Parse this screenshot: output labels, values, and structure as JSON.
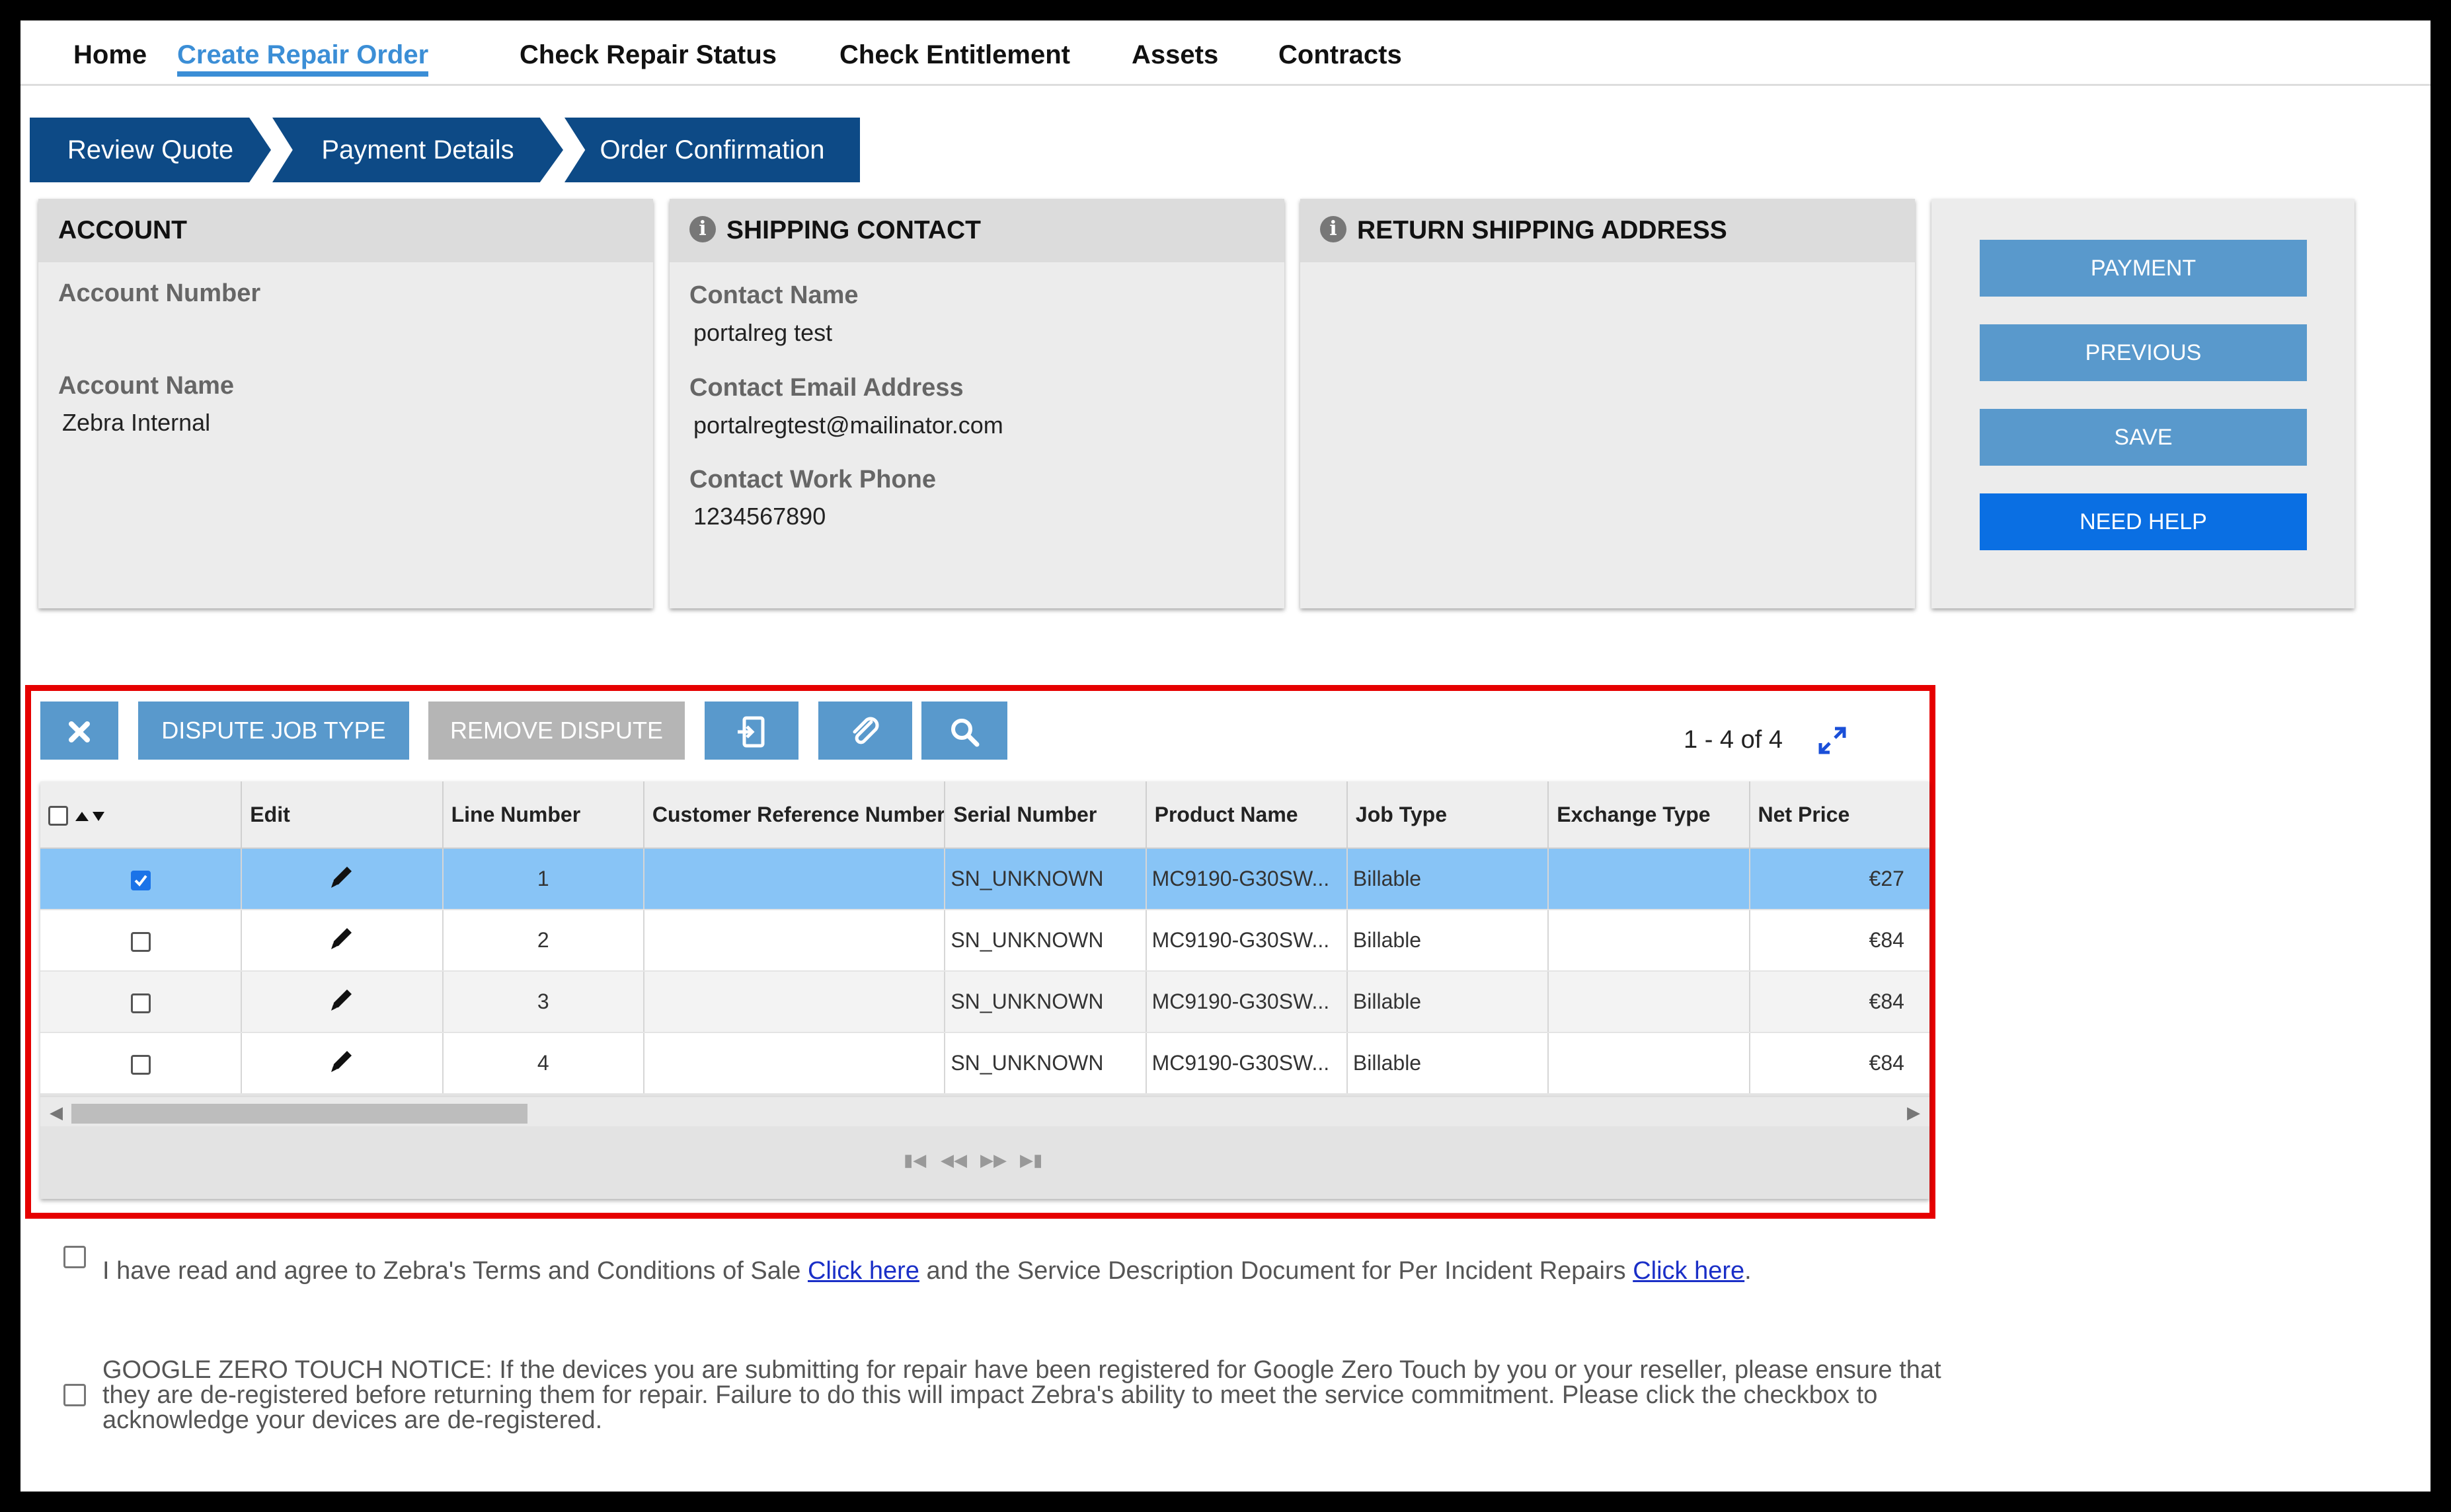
{
  "nav": {
    "items": [
      "Home",
      "Create Repair Order",
      "Check Repair Status",
      "Check Entitlement",
      "Assets",
      "Contracts"
    ],
    "active_index": 1
  },
  "steps": [
    "Review Quote",
    "Payment Details",
    "Order Confirmation"
  ],
  "account": {
    "title": "ACCOUNT",
    "number_label": "Account Number",
    "number_value": "",
    "name_label": "Account Name",
    "name_value": "Zebra Internal"
  },
  "shipping_contact": {
    "title": "SHIPPING CONTACT",
    "name_label": "Contact Name",
    "name_value": "portalreg test",
    "email_label": "Contact Email Address",
    "email_value": "portalregtest@mailinator.com",
    "phone_label": "Contact Work Phone",
    "phone_value": "1234567890"
  },
  "return_address": {
    "title": "RETURN SHIPPING ADDRESS"
  },
  "side_buttons": {
    "payment": "PAYMENT",
    "previous": "PREVIOUS",
    "save": "SAVE",
    "help": "NEED HELP"
  },
  "toolbar": {
    "dispute": "DISPUTE JOB TYPE",
    "remove_dispute": "REMOVE DISPUTE",
    "pager": "1 - 4 of 4"
  },
  "grid": {
    "columns": [
      "Edit",
      "Line Number",
      "Customer Reference Number",
      "Serial Number",
      "Product Name",
      "Job Type",
      "Exchange Type",
      "Net Price"
    ],
    "rows": [
      {
        "checked": true,
        "line": "1",
        "ref": "",
        "serial": "SN_UNKNOWN",
        "product": "MC9190-G30SW...",
        "job": "Billable",
        "exchange": "",
        "price": "€27"
      },
      {
        "checked": false,
        "line": "2",
        "ref": "",
        "serial": "SN_UNKNOWN",
        "product": "MC9190-G30SW...",
        "job": "Billable",
        "exchange": "",
        "price": "€84"
      },
      {
        "checked": false,
        "line": "3",
        "ref": "",
        "serial": "SN_UNKNOWN",
        "product": "MC9190-G30SW...",
        "job": "Billable",
        "exchange": "",
        "price": "€84"
      },
      {
        "checked": false,
        "line": "4",
        "ref": "",
        "serial": "SN_UNKNOWN",
        "product": "MC9190-G30SW...",
        "job": "Billable",
        "exchange": "",
        "price": "€84"
      }
    ]
  },
  "terms": {
    "part1": "I have read and agree to Zebra's Terms and Conditions of Sale ",
    "link1": "Click here",
    "part2": " and the Service Description Document for Per Incident Repairs ",
    "link2": "Click here",
    "part3": "."
  },
  "notice": {
    "text": "GOOGLE ZERO TOUCH NOTICE: If the devices you are submitting for repair have been registered for Google Zero Touch by you or your reseller, please ensure that they are de-registered before returning them for repair. Failure to do this will impact Zebra's ability to meet the service commitment. Please click the checkbox to acknowledge your devices are de-registered."
  },
  "colors": {
    "accent": "#3b8ed6",
    "step_bg": "#0d4a86",
    "button": "#5999cc",
    "help_button": "#0a6fe3",
    "highlight_border": "#e60000",
    "selected_row": "#88c4f6"
  }
}
